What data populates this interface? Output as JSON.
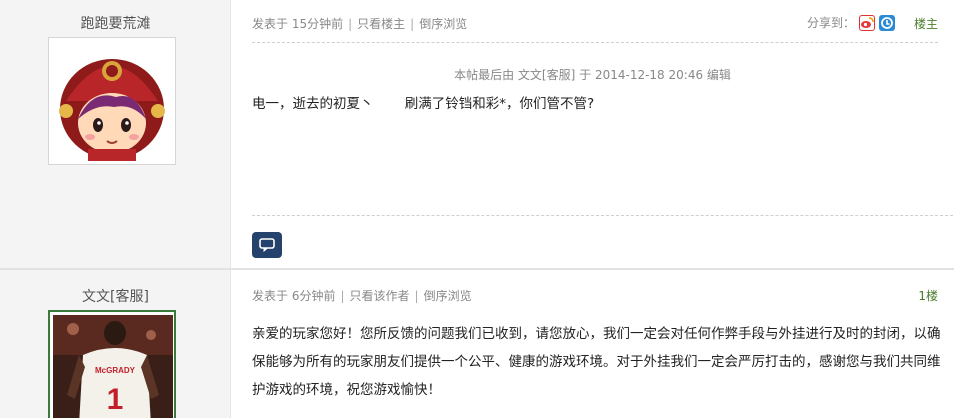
{
  "posts": [
    {
      "author": "跑跑要荒滩",
      "meta": {
        "posted": "发表于 15分钟前",
        "filter_link": "只看楼主",
        "order_link": "倒序浏览"
      },
      "share_label": "分享到：",
      "share_icons": [
        "weibo-icon",
        "qzone-icon"
      ],
      "floor": "楼主",
      "edit_notice": {
        "prefix": "本帖最后由",
        "editor": "文文[客服]",
        "middle": "于",
        "time": "2014-12-18 20:46",
        "suffix": "编辑"
      },
      "content": "电一，逝去的初夏丶　　 刷满了铃铛和彩*，你们管不管?",
      "comment_icon": "comment-icon"
    },
    {
      "author": "文文[客服]",
      "meta": {
        "posted": "发表于 6分钟前",
        "filter_link": "只看该作者",
        "order_link": "倒序浏览"
      },
      "floor": "1楼",
      "content": "亲爱的玩家您好！您所反馈的问题我们已收到，请您放心，我们一定会对任何作弊手段与外挂进行及时的封闭，以确保能够为所有的玩家朋友们提供一个公平、健康的游戏环境。对于外挂我们一定会严厉打击的，感谢您与我们共同维护游戏的环境，祝您游戏愉快！"
    }
  ],
  "colors": {
    "floor_text": "#4a7d2c",
    "comment_button": "#24426b",
    "sidebar_bg": "#f4f4f4"
  }
}
